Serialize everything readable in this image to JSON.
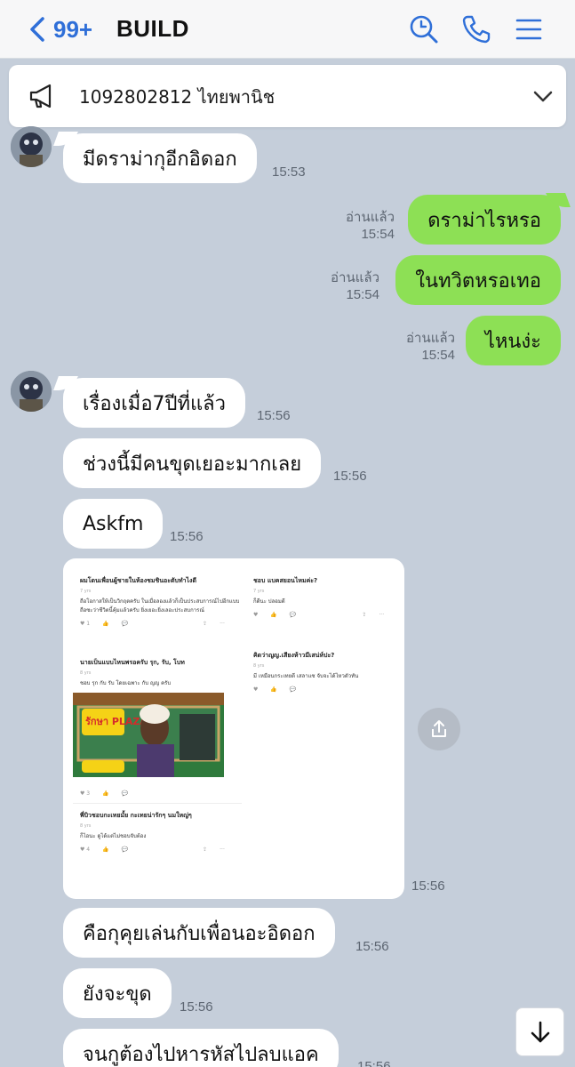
{
  "header": {
    "back_count": "99+",
    "title": "BUILD",
    "accent": "#2f6fd8"
  },
  "announcement": {
    "text": "1092802812 ไทยพานิช"
  },
  "messages": [
    {
      "side": "in",
      "text": "มีดราม่ากุอีกอิดอก",
      "time": "15:53"
    },
    {
      "side": "out",
      "text": "ดราม่าไรหรอ",
      "status": "อ่านแล้ว",
      "time": "15:54"
    },
    {
      "side": "out",
      "text": "ในทวิตหรอเทอ",
      "status": "อ่านแล้ว",
      "time": "15:54"
    },
    {
      "side": "out",
      "text": "ไหนง่ะ",
      "status": "อ่านแล้ว",
      "time": "15:54"
    },
    {
      "side": "in",
      "text": "เรื่องเมื่อ7ปีที่แล้ว",
      "time": "15:56"
    },
    {
      "side": "in",
      "text": "ช่วงนี้มีคนขุดเยอะมากเลย",
      "time": "15:56"
    },
    {
      "side": "in",
      "text": "Askfm",
      "time": "15:56"
    },
    {
      "side": "in",
      "type": "image",
      "time": "15:56"
    },
    {
      "side": "in",
      "text": "คือกุคุยเล่นกับเพื่อนอะอิดอก",
      "time": "15:56"
    },
    {
      "side": "in",
      "text": "ยังจะขุด",
      "time": "15:56"
    },
    {
      "side": "in",
      "text": "จนกูต้องไปหารหัสไปลบแอค",
      "time": "15:56"
    }
  ],
  "screenshot": {
    "posts": [
      {
        "q": "ผมโดนเพื่อนผู้ชายในห้องชมชินอะตับทำไงดี",
        "ago": "7 yrs",
        "a": "ถือโอกาสให้เป็นวิกฤตครับ ในเมื่อลองแล้วก็เป็นประสบการณ์ไปอีกแบบ ถือซะว่าชีวิตนี้คุ้มแล้วครับ ยิ่งเยอะยิ่งเลอะประสบการณ์",
        "likes": "1"
      },
      {
        "q": "นายเป็นแบบไหนพรอครับ รุก, รับ, โบท",
        "ago": "8 yrs",
        "a": "ชอบ รุก กับ รับ โดยเฉพาะ กับ ญญ ครับ",
        "likes": "3",
        "image_caption": "รักษา PLAZAAA"
      },
      {
        "q": "พี่บิวชอบกะเทยมั้ย กะเทยน่ารักๆ นมใหญ่ๆ",
        "ago": "8 yrs",
        "a": "ก็ไอนะ ดูได้แต่ไม่ชอบจับต้อง",
        "likes": "4"
      },
      {
        "q": "ชอบ แบคสยอนไหมค่ะ?",
        "ago": "7 yrs",
        "a": "ก็ดีนะ ปลอมดี",
        "likes": ""
      },
      {
        "q": "คิดว่าญญ.เสียงห้าวมีเสน่ห์ปะ?",
        "ago": "8 yrs",
        "a": "มี เหมือนกระเทยดี เสลาแซ จับจะได้ไหวตัวทัน",
        "likes": ""
      }
    ]
  }
}
